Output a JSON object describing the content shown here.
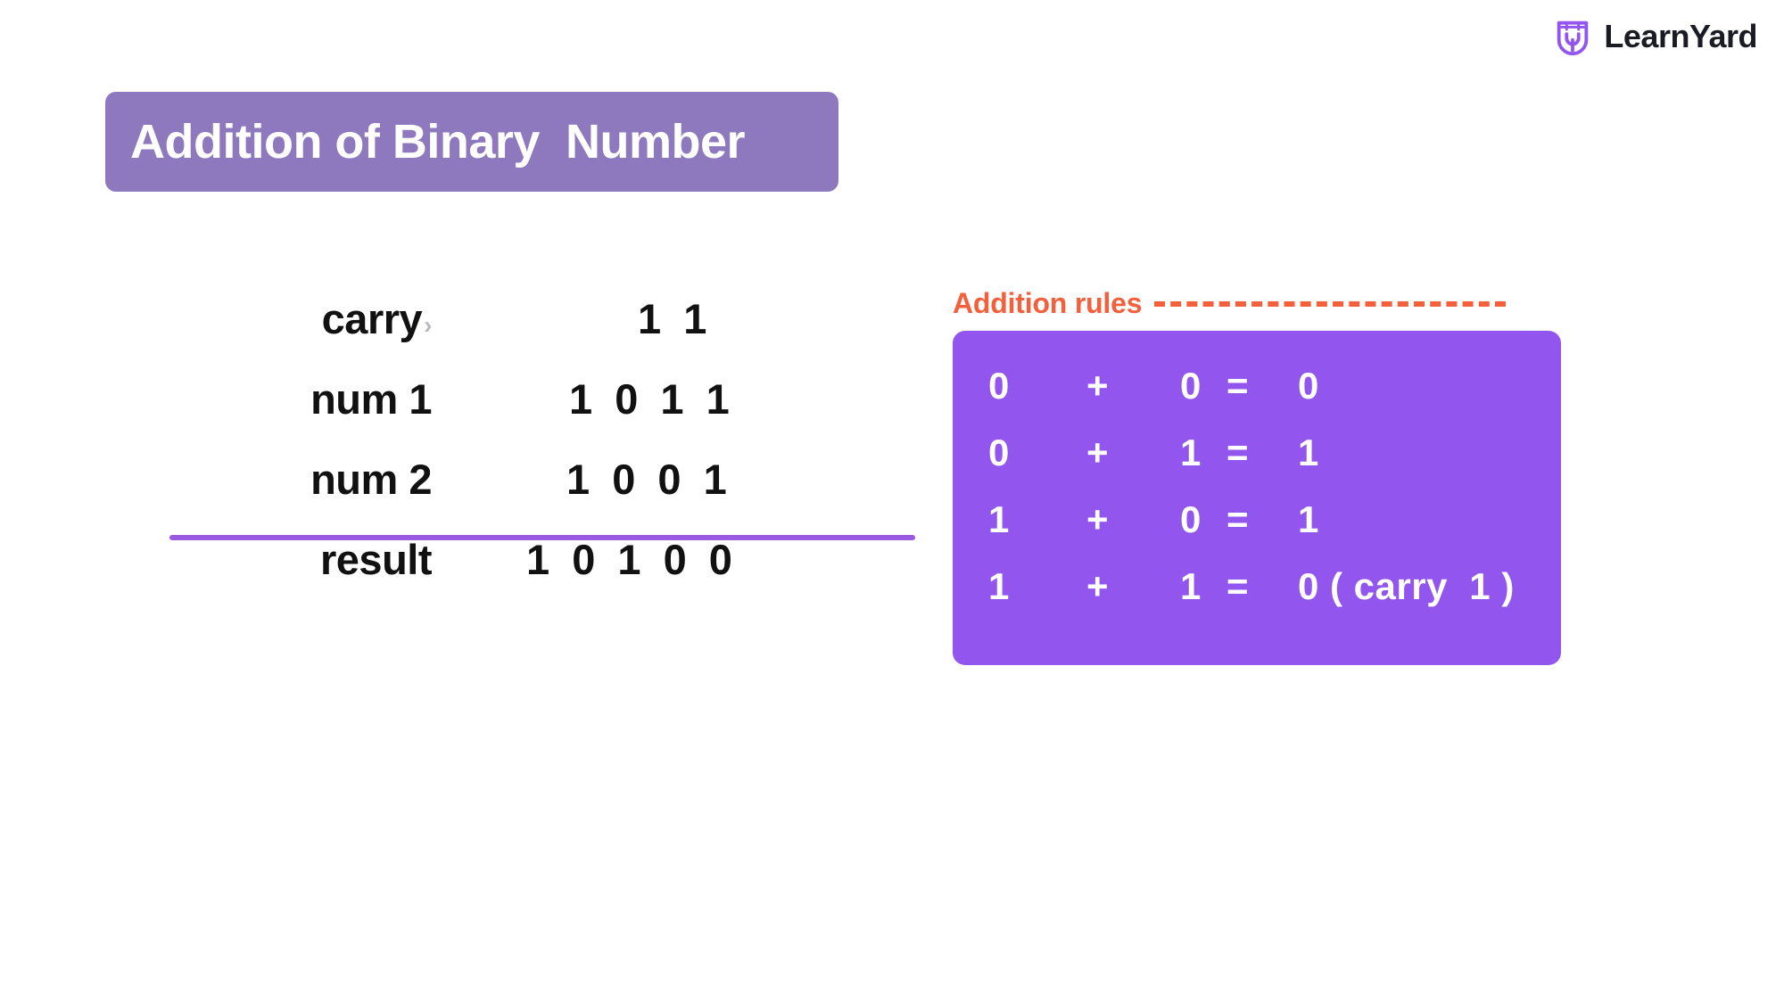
{
  "brand": {
    "name": "LearnYard",
    "logo_icon": "learnyard-shield-icon",
    "accent": "#9255ee"
  },
  "title": {
    "text": "Addition of Binary  Number",
    "background": "#8e78be",
    "color": "#ffffff"
  },
  "worksheet": {
    "rows": [
      {
        "label": "carry",
        "chevron": "›",
        "digits": "1 1"
      },
      {
        "label": "num 1",
        "chevron": "",
        "digits": "1 0 1 1"
      },
      {
        "label": "num 2",
        "chevron": "",
        "digits": "1 0 0 1"
      },
      {
        "label": "result",
        "chevron": "",
        "digits": "1 0 1 0 0"
      }
    ],
    "divider_color": "#9b58e0"
  },
  "rules": {
    "header": "Addition rules",
    "header_color": "#f4603c",
    "box_color": "#9255ee",
    "items": [
      {
        "a": "0",
        "op": "+",
        "b": "0",
        "eq": "=",
        "result": "0"
      },
      {
        "a": "0",
        "op": "+",
        "b": "1",
        "eq": "=",
        "result": "1"
      },
      {
        "a": "1",
        "op": "+",
        "b": "0",
        "eq": "=",
        "result": "1"
      },
      {
        "a": "1",
        "op": "+",
        "b": "1",
        "eq": "=",
        "result": "0 ( carry  1 )"
      }
    ]
  }
}
